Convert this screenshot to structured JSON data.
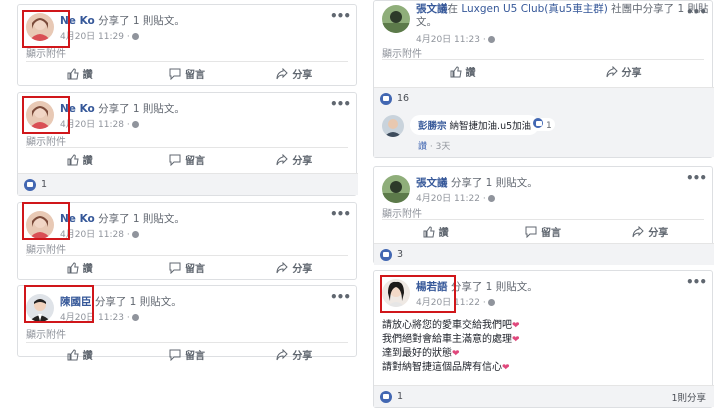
{
  "colors": {
    "link": "#365899",
    "accent": "#4267b2",
    "highlight": "#d0161a"
  },
  "common": {
    "shared_text": "分享了 1 則貼文。",
    "show_attachment": "顯示附件",
    "like": "讚",
    "comment": "留言",
    "share": "分享",
    "more": "•••"
  },
  "left": {
    "posts": [
      {
        "name": "Ne Ko",
        "time": "4月20日 11:29 ·"
      },
      {
        "name": "Ne Ko",
        "time": "4月20日 11:28 ·",
        "likes": "1"
      },
      {
        "name": "Ne Ko",
        "time": "4月20日 11:28 ·"
      },
      {
        "name": "陳國臣",
        "time": "4月20日 11:23 ·"
      }
    ]
  },
  "right": {
    "post1": {
      "name": "張文議",
      "middle": "在",
      "group": "Luxgen U5 Club(真u5車主群)",
      "suffix": "社團中分享了 1 則貼",
      "suffix2": "文。",
      "time": "4月20日 11:23 ·",
      "likes": "16",
      "comment": {
        "name": "彭勝宗",
        "text": "納智捷加油.u5加油",
        "likes": "1",
        "like_label": "讚",
        "age": "3天"
      }
    },
    "post2": {
      "name": "張文議",
      "time": "4月20日 11:22 ·",
      "likes": "3"
    },
    "post3": {
      "name": "楊若語",
      "time": "4月20日 11:22 ·",
      "lines": [
        "請放心將您的愛車交給我們吧",
        "我們絕對會給車主滿意的處理",
        "達到最好的狀態",
        "請對納智捷這個品牌有信心"
      ],
      "likes": "1",
      "shares": "1則分享"
    }
  }
}
